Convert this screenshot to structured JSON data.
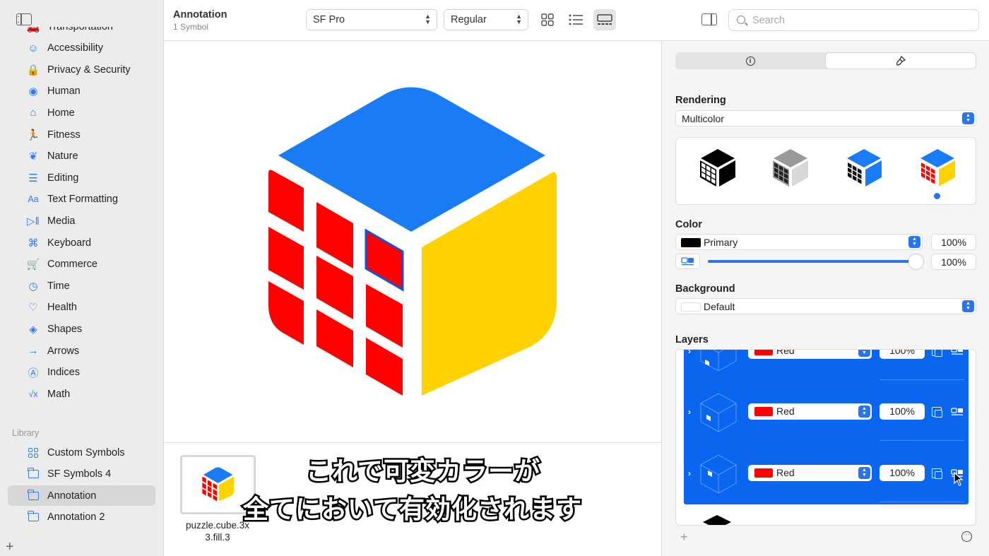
{
  "sidebar": {
    "categories": [
      {
        "label": "Transportation",
        "icon": "car-icon"
      },
      {
        "label": "Accessibility",
        "icon": "accessibility-icon"
      },
      {
        "label": "Privacy & Security",
        "icon": "lock-icon"
      },
      {
        "label": "Human",
        "icon": "person-circle-icon"
      },
      {
        "label": "Home",
        "icon": "house-icon"
      },
      {
        "label": "Fitness",
        "icon": "figure-run-icon"
      },
      {
        "label": "Nature",
        "icon": "leaf-icon"
      },
      {
        "label": "Editing",
        "icon": "slider-icon"
      },
      {
        "label": "Text Formatting",
        "icon": "textformat-icon"
      },
      {
        "label": "Media",
        "icon": "play-pause-icon"
      },
      {
        "label": "Keyboard",
        "icon": "command-icon"
      },
      {
        "label": "Commerce",
        "icon": "cart-icon"
      },
      {
        "label": "Time",
        "icon": "clock-icon"
      },
      {
        "label": "Health",
        "icon": "heart-icon"
      },
      {
        "label": "Shapes",
        "icon": "shapes-icon"
      },
      {
        "label": "Arrows",
        "icon": "arrow-right-icon"
      },
      {
        "label": "Indices",
        "icon": "a-circle-icon"
      },
      {
        "label": "Math",
        "icon": "squareroot-icon"
      }
    ],
    "library_header": "Library",
    "library": [
      {
        "label": "Custom Symbols",
        "icon": "grid-icon"
      },
      {
        "label": "SF Symbols 4",
        "icon": "folder-icon"
      },
      {
        "label": "Annotation",
        "icon": "folder-icon",
        "selected": true
      },
      {
        "label": "Annotation 2",
        "icon": "folder-icon"
      }
    ],
    "add_label": "+"
  },
  "toolbar": {
    "title": "Annotation",
    "subtitle": "1 Symbol",
    "font": "SF Pro",
    "weight": "Regular",
    "search_placeholder": "Search",
    "active_view": "gallery"
  },
  "gallery": {
    "symbol_name": "puzzle.cube.3x3.fill.3",
    "symbol_name_line1": "puzzle.cube.3x",
    "symbol_name_line2": "3.fill.3"
  },
  "caption": {
    "line1": "これで可変カラーが",
    "line2": "全てにおいて有効化されます"
  },
  "inspector": {
    "rendering_label": "Rendering",
    "rendering_mode": "Multicolor",
    "rendering_options": [
      "monochrome",
      "hierarchical",
      "palette",
      "multicolor"
    ],
    "selected_rendering": "multicolor",
    "color_label": "Color",
    "color_value": "Primary",
    "color_percent": "100%",
    "opacity_percent": "100%",
    "opacity_fraction": 1.0,
    "background_label": "Background",
    "background_value": "Default",
    "layers_label": "Layers",
    "layers": [
      {
        "color": "Red",
        "percent": "100%"
      },
      {
        "color": "Red",
        "percent": "100%"
      },
      {
        "color": "Red",
        "percent": "100%"
      }
    ],
    "add_label": "+",
    "more_label": "···"
  },
  "colors": {
    "accent": "#2a74f0",
    "cube_top": "#1a7cf5",
    "cube_left": "#ff0000",
    "cube_right": "#ffd200",
    "selection": "#0a66ef"
  }
}
